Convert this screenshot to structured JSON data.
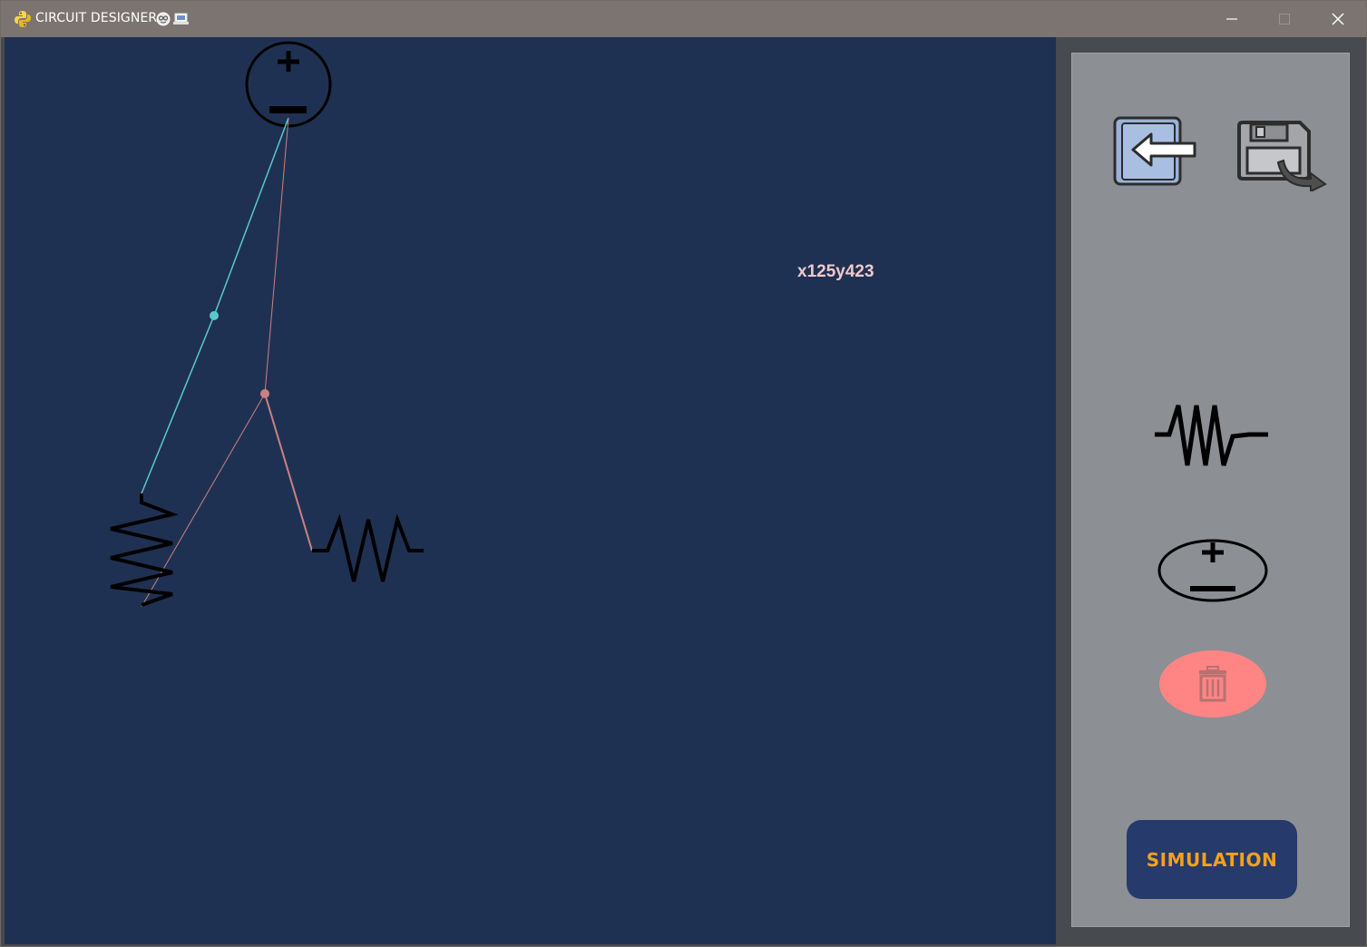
{
  "window": {
    "title": "CIRCUIT DESIGNER",
    "title_emoji": "🤓💻",
    "app_icon": "python-snake-icon",
    "controls": [
      "minimize-icon",
      "maximize-icon",
      "close-icon"
    ]
  },
  "canvas": {
    "background": "#1f3152",
    "cursor_readout": "x125y423",
    "components": [
      {
        "type": "dc-source",
        "icon": "voltage-source-icon"
      },
      {
        "type": "resistor",
        "orientation": "vertical",
        "icon": "resistor-icon"
      },
      {
        "type": "resistor",
        "orientation": "horizontal",
        "icon": "resistor-icon"
      }
    ],
    "wires": [
      {
        "color": "#58c9cf",
        "label": "cyan wire"
      },
      {
        "color": "#c98284",
        "label": "pink wire"
      }
    ]
  },
  "palette": {
    "background": "#8c8f94",
    "tools": [
      {
        "name": "back",
        "icon": "back-arrow-icon"
      },
      {
        "name": "save",
        "icon": "floppy-save-icon"
      },
      {
        "name": "resistor",
        "icon": "resistor-icon"
      },
      {
        "name": "dc-source",
        "icon": "voltage-source-icon"
      },
      {
        "name": "delete",
        "icon": "trash-icon",
        "color": "#ff8585"
      }
    ],
    "simulation_label": "SIMULATION",
    "simulation_bg": "#263a6b",
    "simulation_fg": "#f2a21e"
  }
}
